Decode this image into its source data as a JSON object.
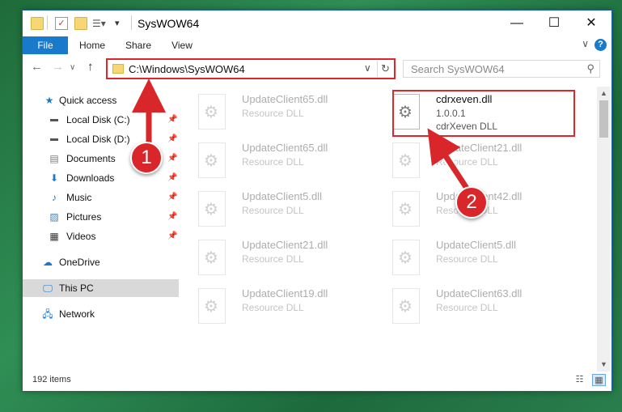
{
  "window": {
    "title": "SysWOW64"
  },
  "ribbon": {
    "tabs": [
      "File",
      "Home",
      "Share",
      "View"
    ],
    "help": "?"
  },
  "address": {
    "path": "C:\\Windows\\SysWOW64"
  },
  "search": {
    "placeholder": "Search SysWOW64"
  },
  "sidebar": {
    "items": [
      {
        "label": "Quick access",
        "icon": "star-icon"
      },
      {
        "label": "Local Disk (C:)",
        "icon": "drive-icon"
      },
      {
        "label": "Local Disk (D:)",
        "icon": "drive-icon"
      },
      {
        "label": "Documents",
        "icon": "documents-icon"
      },
      {
        "label": "Downloads",
        "icon": "download-icon"
      },
      {
        "label": "Music",
        "icon": "music-icon"
      },
      {
        "label": "Pictures",
        "icon": "pictures-icon"
      },
      {
        "label": "Videos",
        "icon": "videos-icon"
      },
      {
        "label": "OneDrive",
        "icon": "cloud-icon"
      },
      {
        "label": "This PC",
        "icon": "computer-icon"
      },
      {
        "label": "Network",
        "icon": "network-icon"
      }
    ]
  },
  "files": [
    {
      "name": "UpdateClient65.dll",
      "type": "Resource DLL"
    },
    {
      "name": "cdrxeven.dll",
      "version": "1.0.0.1",
      "type": "cdrXeven DLL"
    },
    {
      "name": "UpdateClient65.dll",
      "type": "Resource DLL"
    },
    {
      "name": "UpdateClient21.dll",
      "type": "Resource DLL"
    },
    {
      "name": "UpdateClient5.dll",
      "type": "Resource DLL"
    },
    {
      "name": "UpdateClient42.dll",
      "type": "Resource DLL"
    },
    {
      "name": "UpdateClient21.dll",
      "type": "Resource DLL"
    },
    {
      "name": "UpdateClient5.dll",
      "type": "Resource DLL"
    },
    {
      "name": "UpdateClient19.dll",
      "type": "Resource DLL"
    },
    {
      "name": "UpdateClient63.dll",
      "type": "Resource DLL"
    }
  ],
  "status": {
    "count": "192 items"
  },
  "callouts": [
    "1",
    "2"
  ],
  "colors": {
    "accent": "#1979ca",
    "highlight": "#e0262b",
    "selected": "#d9d9d9"
  }
}
